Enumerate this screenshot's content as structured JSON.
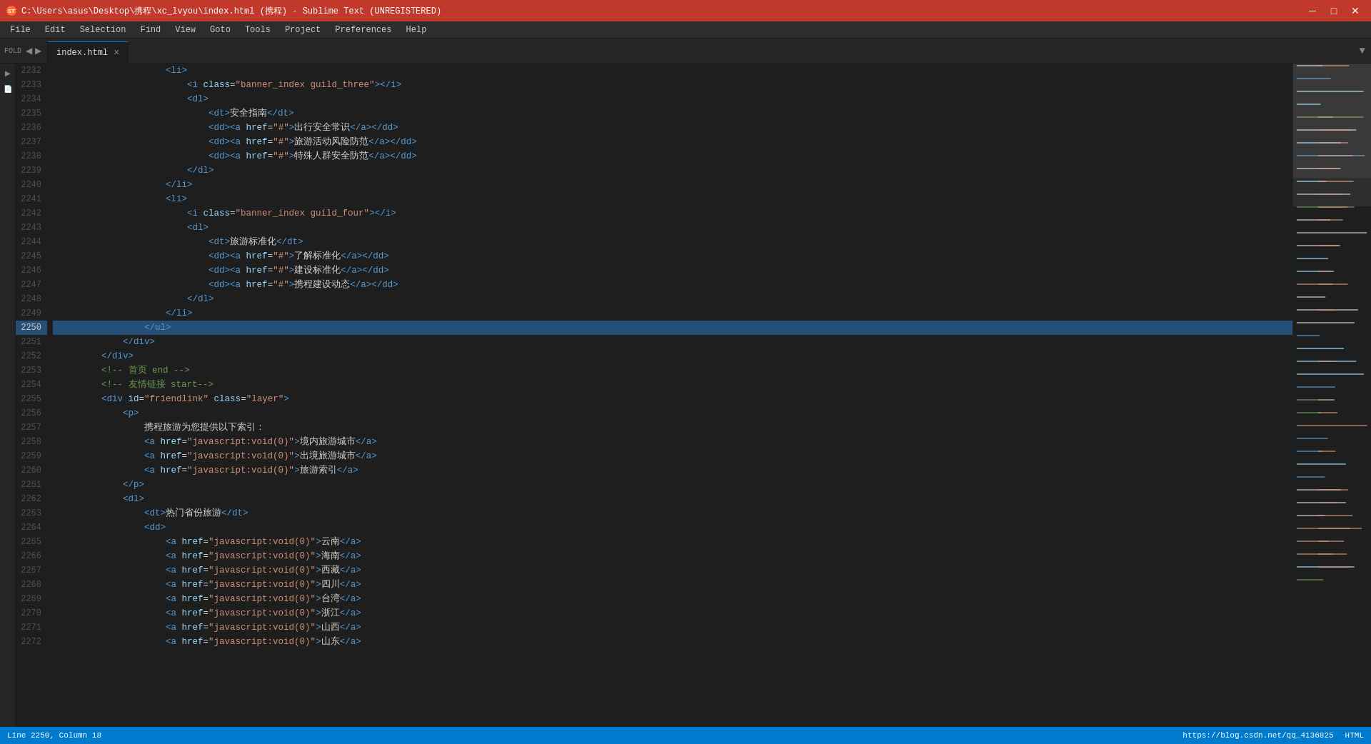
{
  "titleBar": {
    "icon": "ST",
    "title": "C:\\Users\\asus\\Desktop\\携程\\xc_lvyou\\index.html (携程) - Sublime Text (UNREGISTERED)",
    "controls": {
      "minimize": "─",
      "maximize": "□",
      "close": "✕"
    }
  },
  "menuBar": {
    "items": [
      "File",
      "Edit",
      "Selection",
      "Find",
      "View",
      "Goto",
      "Tools",
      "Project",
      "Preferences",
      "Help"
    ]
  },
  "tabs": [
    {
      "label": "index.html",
      "active": true,
      "close": "×"
    }
  ],
  "foldLabel": "FOLD",
  "tabArrow": "▼",
  "editor": {
    "lines": [
      {
        "num": "2232",
        "content": "                    <li>",
        "highlighted": false
      },
      {
        "num": "2233",
        "content": "                        <i class=\"banner_index guild_three\"></i>",
        "highlighted": false
      },
      {
        "num": "2234",
        "content": "                        <dl>",
        "highlighted": false
      },
      {
        "num": "2235",
        "content": "                            <dt>安全指南</dt>",
        "highlighted": false
      },
      {
        "num": "2236",
        "content": "                            <dd><a href=\"#\">出行安全常识</a></dd>",
        "highlighted": false
      },
      {
        "num": "2237",
        "content": "                            <dd><a href=\"#\">旅游活动风险防范</a></dd>",
        "highlighted": false
      },
      {
        "num": "2238",
        "content": "                            <dd><a href=\"#\">特殊人群安全防范</a></dd>",
        "highlighted": false
      },
      {
        "num": "2239",
        "content": "                        </dl>",
        "highlighted": false
      },
      {
        "num": "2240",
        "content": "                    </li>",
        "highlighted": false
      },
      {
        "num": "2241",
        "content": "                    <li>",
        "highlighted": false
      },
      {
        "num": "2242",
        "content": "                        <i class=\"banner_index guild_four\"></i>",
        "highlighted": false
      },
      {
        "num": "2243",
        "content": "                        <dl>",
        "highlighted": false
      },
      {
        "num": "2244",
        "content": "                            <dt>旅游标准化</dt>",
        "highlighted": false
      },
      {
        "num": "2245",
        "content": "                            <dd><a href=\"#\">了解标准化</a></dd>",
        "highlighted": false
      },
      {
        "num": "2246",
        "content": "                            <dd><a href=\"#\">建设标准化</a></dd>",
        "highlighted": false
      },
      {
        "num": "2247",
        "content": "                            <dd><a href=\"#\">携程建设动态</a></dd>",
        "highlighted": false
      },
      {
        "num": "2248",
        "content": "                        </dl>",
        "highlighted": false
      },
      {
        "num": "2249",
        "content": "                    </li>",
        "highlighted": false
      },
      {
        "num": "2250",
        "content": "                </ul>",
        "highlighted": true
      },
      {
        "num": "2251",
        "content": "            </div>",
        "highlighted": false
      },
      {
        "num": "2252",
        "content": "        </div>",
        "highlighted": false
      },
      {
        "num": "2253",
        "content": "        <!-- 首页 end -->",
        "highlighted": false
      },
      {
        "num": "2254",
        "content": "        <!-- 友情链接 start-->",
        "highlighted": false
      },
      {
        "num": "2255",
        "content": "        <div id=\"friendlink\" class=\"layer\">",
        "highlighted": false
      },
      {
        "num": "2256",
        "content": "            <p>",
        "highlighted": false
      },
      {
        "num": "2257",
        "content": "                携程旅游为您提供以下索引：",
        "highlighted": false
      },
      {
        "num": "2258",
        "content": "                <a href=\"javascript:void(0)\">境内旅游城市</a>",
        "highlighted": false
      },
      {
        "num": "2259",
        "content": "                <a href=\"javascript:void(0)\">出境旅游城市</a>",
        "highlighted": false
      },
      {
        "num": "2260",
        "content": "                <a href=\"javascript:void(0)\">旅游索引</a>",
        "highlighted": false
      },
      {
        "num": "2261",
        "content": "            </p>",
        "highlighted": false
      },
      {
        "num": "2262",
        "content": "            <dl>",
        "highlighted": false
      },
      {
        "num": "2263",
        "content": "                <dt>热门省份旅游</dt>",
        "highlighted": false
      },
      {
        "num": "2264",
        "content": "                <dd>",
        "highlighted": false
      },
      {
        "num": "2265",
        "content": "                    <a href=\"javascript:void(0)\">云南</a>",
        "highlighted": false
      },
      {
        "num": "2266",
        "content": "                    <a href=\"javascript:void(0)\">海南</a>",
        "highlighted": false
      },
      {
        "num": "2267",
        "content": "                    <a href=\"javascript:void(0)\">西藏</a>",
        "highlighted": false
      },
      {
        "num": "2268",
        "content": "                    <a href=\"javascript:void(0)\">四川</a>",
        "highlighted": false
      },
      {
        "num": "2269",
        "content": "                    <a href=\"javascript:void(0)\">台湾</a>",
        "highlighted": false
      },
      {
        "num": "2270",
        "content": "                    <a href=\"javascript:void(0)\">浙江</a>",
        "highlighted": false
      },
      {
        "num": "2271",
        "content": "                    <a href=\"javascript:void(0)\">山西</a>",
        "highlighted": false
      },
      {
        "num": "2272",
        "content": "                    <a href=\"javascript:void(0)\">山东</a>",
        "highlighted": false
      }
    ]
  },
  "statusBar": {
    "left": {
      "position": "Line 2250, Column 18",
      "info": ""
    },
    "right": {
      "url": "https://blog.csdn.net/qq_4136825",
      "encoding": "HTML"
    }
  }
}
